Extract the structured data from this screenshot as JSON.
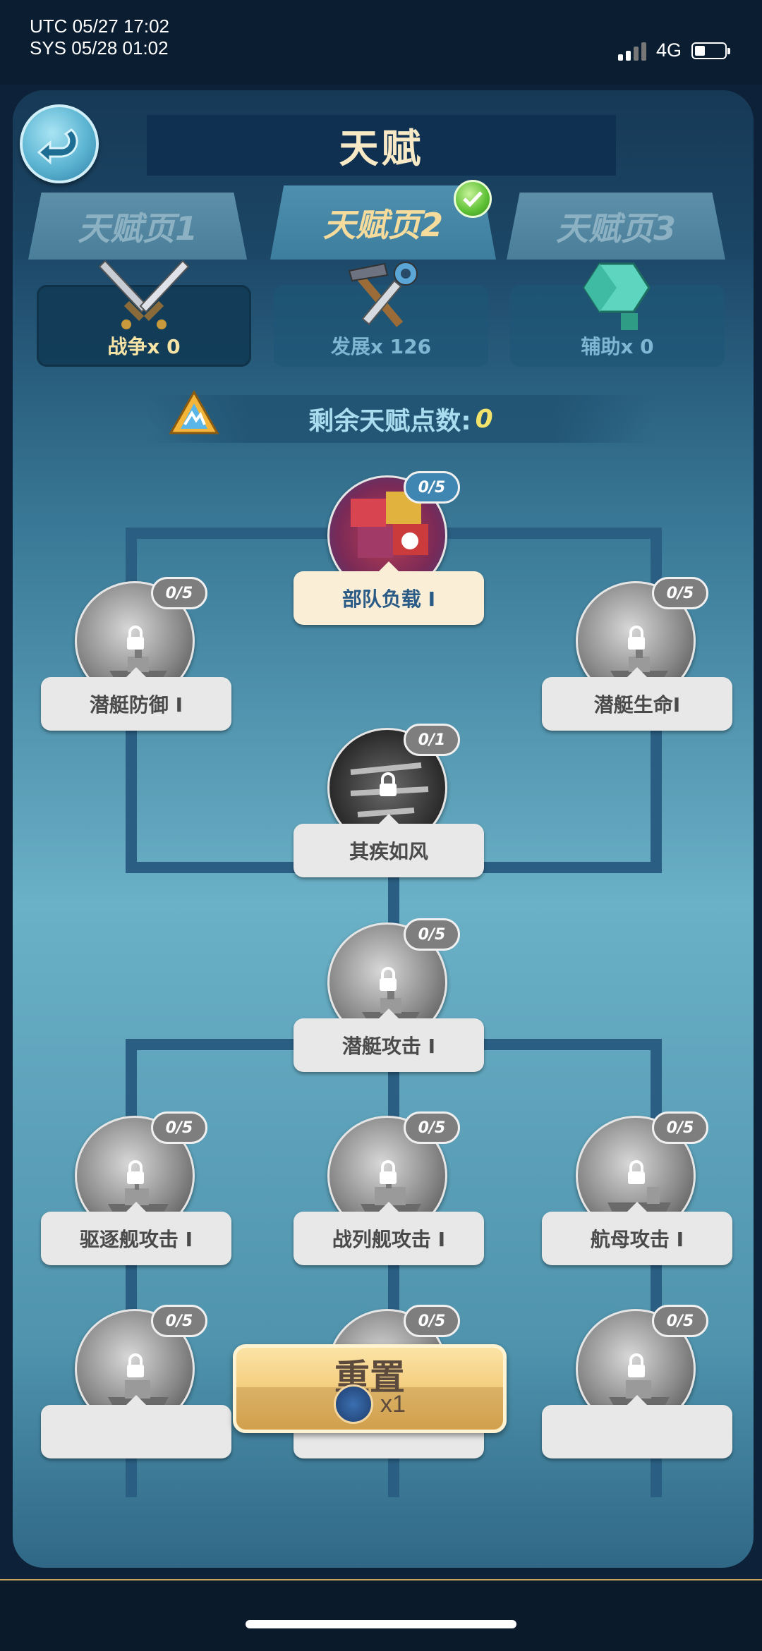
{
  "status": {
    "utc": "UTC 05/27 17:02",
    "sys": "SYS 05/28 01:02",
    "network": "4G"
  },
  "header": {
    "title": "天赋"
  },
  "tabs": [
    {
      "label": "天赋页1"
    },
    {
      "label": "天赋页2",
      "active": true
    },
    {
      "label": "天赋页3"
    }
  ],
  "categories": [
    {
      "label": "战争x 0",
      "icon": "crossed-swords-icon",
      "color": "#f6e3a6"
    },
    {
      "label": "发展x 126",
      "icon": "hammer-wrench-icon",
      "color": "#7fb6d2"
    },
    {
      "label": "辅助x 0",
      "icon": "gem-icon",
      "color": "#7fb6d2"
    }
  ],
  "points": {
    "label": "剩余天赋点数:",
    "value": "0"
  },
  "nodes": {
    "troop_load": {
      "label": "部队负载 I",
      "count": "0/5"
    },
    "sub_defense": {
      "label": "潜艇防御 I",
      "count": "0/5"
    },
    "sub_life": {
      "label": "潜艇生命I",
      "count": "0/5"
    },
    "swift_wind": {
      "label": "其疾如风",
      "count": "0/1"
    },
    "sub_attack": {
      "label": "潜艇攻击 I",
      "count": "0/5"
    },
    "destroyer_attack": {
      "label": "驱逐舰攻击 I",
      "count": "0/5"
    },
    "battleship_attack": {
      "label": "战列舰攻击 I",
      "count": "0/5"
    },
    "carrier_attack": {
      "label": "航母攻击 I",
      "count": "0/5"
    },
    "row4_left": {
      "count": "0/5"
    },
    "row4_mid": {
      "count": "0/5"
    },
    "row4_right": {
      "count": "0/5"
    }
  },
  "reset": {
    "label": "重置",
    "count": "x1"
  }
}
